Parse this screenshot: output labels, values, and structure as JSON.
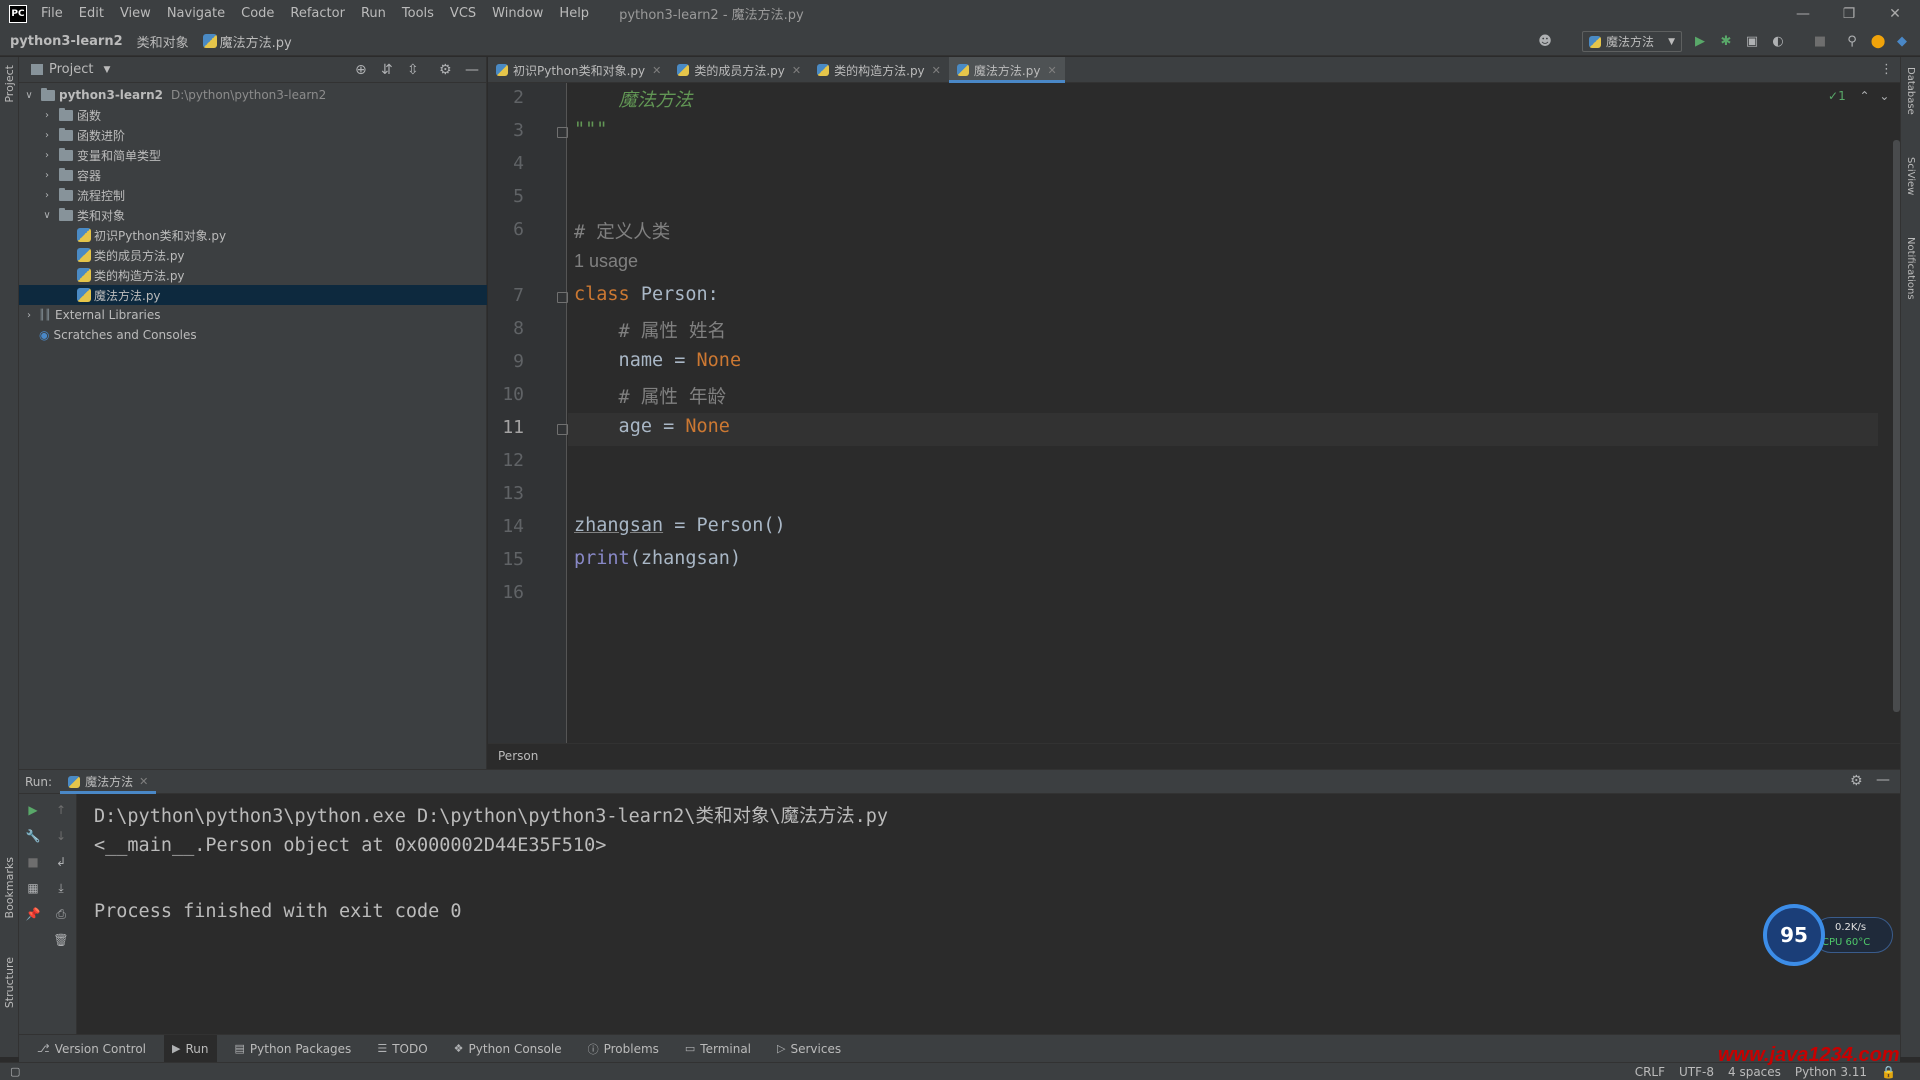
{
  "titlebar": {
    "logo": "PC",
    "menu": [
      "File",
      "Edit",
      "View",
      "Navigate",
      "Code",
      "Refactor",
      "Run",
      "Tools",
      "VCS",
      "Window",
      "Help"
    ],
    "title": "python3-learn2 - 魔法方法.py"
  },
  "navbar": {
    "crumbs": [
      "python3-learn2",
      "类和对象",
      "魔法方法.py"
    ],
    "run_config": "魔法方法"
  },
  "left_strip": {
    "project": "Project",
    "bookmarks": "Bookmarks",
    "structure": "Structure"
  },
  "right_strip": {
    "database": "Database",
    "sciview": "SciView",
    "notifications": "Notifications"
  },
  "project_panel": {
    "header": "Project",
    "tree": [
      {
        "label": "python3-learn2",
        "path": "D:\\python\\python3-learn2",
        "kind": "root",
        "expanded": true
      },
      {
        "label": "函数",
        "kind": "folder",
        "expanded": false
      },
      {
        "label": "函数进阶",
        "kind": "folder",
        "expanded": false
      },
      {
        "label": "变量和简单类型",
        "kind": "folder",
        "expanded": false
      },
      {
        "label": "容器",
        "kind": "folder",
        "expanded": false
      },
      {
        "label": "流程控制",
        "kind": "folder",
        "expanded": false
      },
      {
        "label": "类和对象",
        "kind": "folder",
        "expanded": true
      },
      {
        "label": "初识Python类和对象.py",
        "kind": "file"
      },
      {
        "label": "类的成员方法.py",
        "kind": "file"
      },
      {
        "label": "类的构造方法.py",
        "kind": "file"
      },
      {
        "label": "魔法方法.py",
        "kind": "file",
        "selected": true
      },
      {
        "label": "External Libraries",
        "kind": "lib"
      },
      {
        "label": "Scratches and Consoles",
        "kind": "scratch"
      }
    ]
  },
  "editor_tabs": [
    {
      "label": "初识Python类和对象.py",
      "active": false
    },
    {
      "label": "类的成员方法.py",
      "active": false
    },
    {
      "label": "类的构造方法.py",
      "active": false
    },
    {
      "label": "魔法方法.py",
      "active": true
    }
  ],
  "editor": {
    "inspection": "1",
    "lines": [
      {
        "n": "2",
        "parts": [
          {
            "t": "    魔法方法",
            "c": "doc"
          }
        ]
      },
      {
        "n": "3",
        "parts": [
          {
            "t": "\"\"\"",
            "c": "doc"
          }
        ]
      },
      {
        "n": "4",
        "parts": []
      },
      {
        "n": "5",
        "parts": []
      },
      {
        "n": "6",
        "parts": [
          {
            "t": "# 定义人类",
            "c": "cm"
          }
        ]
      },
      {
        "n": "",
        "parts": [
          {
            "t": "1 usage",
            "c": "hint"
          }
        ]
      },
      {
        "n": "7",
        "parts": [
          {
            "t": "class ",
            "c": "kw"
          },
          {
            "t": "Person:",
            "c": ""
          }
        ]
      },
      {
        "n": "8",
        "parts": [
          {
            "t": "    # 属性 姓名",
            "c": "cm"
          }
        ]
      },
      {
        "n": "9",
        "parts": [
          {
            "t": "    name = ",
            "c": ""
          },
          {
            "t": "None",
            "c": "kw"
          }
        ]
      },
      {
        "n": "10",
        "parts": [
          {
            "t": "    # 属性 年龄",
            "c": "cm"
          }
        ]
      },
      {
        "n": "11",
        "parts": [
          {
            "t": "    age = ",
            "c": ""
          },
          {
            "t": "None",
            "c": "kw"
          }
        ]
      },
      {
        "n": "12",
        "parts": []
      },
      {
        "n": "13",
        "parts": []
      },
      {
        "n": "14",
        "parts": [
          {
            "t": "zhangsan",
            "c": "under"
          },
          {
            "t": " = Person()",
            "c": ""
          }
        ]
      },
      {
        "n": "15",
        "parts": [
          {
            "t": "print",
            "c": "bi"
          },
          {
            "t": "(zhangsan)",
            "c": ""
          }
        ]
      },
      {
        "n": "16",
        "parts": []
      }
    ],
    "current_line": "11",
    "breadcrumb": "Person"
  },
  "run_panel": {
    "label": "Run:",
    "tab": "魔法方法",
    "console": [
      "D:\\python\\python3\\python.exe D:\\python\\python3-learn2\\类和对象\\魔法方法.py",
      "<__main__.Person object at 0x000002D44E35F510>",
      "",
      "Process finished with exit code 0"
    ]
  },
  "bottom_tools": [
    {
      "label": "Version Control",
      "icon": "branch-icon",
      "active": false
    },
    {
      "label": "Run",
      "icon": "play-icon",
      "active": true
    },
    {
      "label": "Python Packages",
      "icon": "packages-icon",
      "active": false
    },
    {
      "label": "TODO",
      "icon": "list-icon",
      "active": false
    },
    {
      "label": "Python Console",
      "icon": "python-icon",
      "active": false
    },
    {
      "label": "Problems",
      "icon": "problems-icon",
      "active": false
    },
    {
      "label": "Terminal",
      "icon": "terminal-icon",
      "active": false
    },
    {
      "label": "Services",
      "icon": "services-icon",
      "active": false
    }
  ],
  "status_bar": {
    "line_sep": "CRLF",
    "encoding": "UTF-8",
    "indent": "4 spaces",
    "interpreter": "Python 3.11"
  },
  "perf_widget": {
    "score": "95",
    "speed": "0.2K/s",
    "cpu": "CPU 60°C"
  },
  "watermark": "www.java1234.com"
}
